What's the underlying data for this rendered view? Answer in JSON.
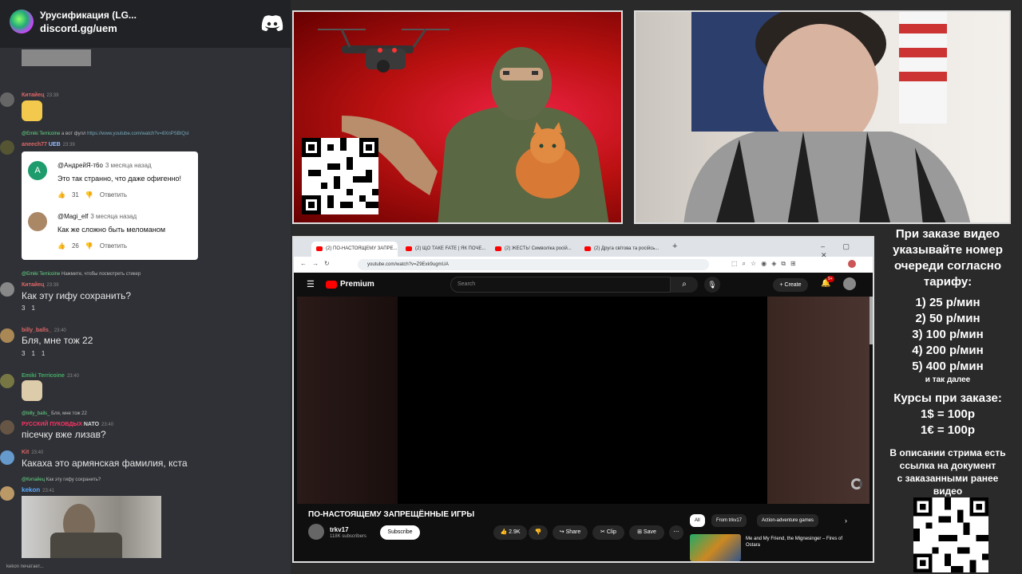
{
  "chat": {
    "server_name": "Урусификация (LG...",
    "server_link": "discord.gg/uem",
    "messages": [
      {
        "user": "Китайец",
        "time": "23:39",
        "color": "#e06666"
      },
      {
        "reply_user": "@Emiki Terricoine",
        "reply_text": "а вот фулл",
        "reply_link": "https://www.youtube.com/watch?v=8XnPSBIQsI",
        "user": "aneech77",
        "badge": "UEB",
        "time": "23:39",
        "color": "#e06666"
      },
      {
        "reply_user": "@Emiki Terricoine",
        "reply_text": "Нажмите, чтобы посмотреть стикер",
        "user": "Китайец",
        "time": "23:39",
        "text": "Как эту гифу сохранить?",
        "reactions": [
          "3",
          "1"
        ],
        "color": "#e06666"
      },
      {
        "user": "billy_balls_",
        "time": "23:40",
        "text": "Бля, мне тож 22",
        "reactions": [
          "3",
          "1",
          "1"
        ],
        "color": "#e06666"
      },
      {
        "user": "Emiki Terricoine",
        "time": "23:40",
        "color": "#44aa66"
      },
      {
        "reply_user": "@billy_balls_",
        "reply_text": "Бля, мне тож 22",
        "user": "РУССКИЙ ПУКОВДЫХ",
        "badge": "NATO",
        "time": "23:40",
        "text": "пісечку вже лизав?",
        "color": "#ff3366"
      },
      {
        "user": "Kit",
        "time": "23:40",
        "text": "Какаха это армянская фамилия, кста",
        "color": "#e06666"
      },
      {
        "reply_user": "@Китайец",
        "reply_text": "Как эту гифу сохранить?",
        "user": "kekon",
        "time": "23:41",
        "color": "#5aa9ff"
      }
    ],
    "youtube_comments": [
      {
        "author": "@АндрейЯ-т6о",
        "ago": "3 месяца назад",
        "text": "Это так странно, что даже офигенно!",
        "likes": "31",
        "reply": "Ответить",
        "avatar_letter": "A"
      },
      {
        "author": "@Magi_elf",
        "ago": "3 месяца назад",
        "text": "Как же сложно быть меломаном",
        "likes": "26",
        "reply": "Ответить"
      }
    ],
    "typing": "kekon печатает..."
  },
  "browser": {
    "tabs": [
      {
        "label": "(2) ПО-НАСТОЯЩЕМУ ЗАПРЕ..."
      },
      {
        "label": "(2) ЩО ТАКЕ FATE | ЯК ПОЧЕ..."
      },
      {
        "label": "(2) ЖЕСТЬ! Символіка росій..."
      },
      {
        "label": "(2) Другa світова та російсь..."
      }
    ],
    "url": "youtube.com/watch?v=Z9Exk9ugmUA"
  },
  "youtube": {
    "brand": "Premium",
    "search_placeholder": "Search",
    "create_label": "Create",
    "notif_count": "9+",
    "video_title": "ПО-НАСТОЯЩЕМУ ЗАПРЕЩЁННЫЕ ИГРЫ",
    "channel_name": "trkv17",
    "channel_subs": "118K subscribers",
    "subscribe_label": "Subscribe",
    "likes": "2.9K",
    "share_label": "Share",
    "clip_label": "Clip",
    "save_label": "Save",
    "chips": [
      "All",
      "From trkv17",
      "Action-adventure games"
    ],
    "rec_title": "Me and My Friend, the Mignesinger – Fires of Ostara"
  },
  "info": {
    "lines": [
      "При заказе видео",
      "указывайте номер",
      "очереди согласно",
      "тарифу:"
    ],
    "tariffs": [
      "1) 25 р/мин",
      "2) 50 р/мин",
      "3) 100 р/мин",
      "4) 200 р/мин",
      "5) 400 р/мин"
    ],
    "etc": "и так далее",
    "courses_title": "Курсы при заказе:",
    "courses": [
      "1$ = 100р",
      "1€ = 100р"
    ],
    "desc": [
      "В описании стрима есть",
      "ссылка на документ",
      "с заказанными ранее",
      "видео"
    ]
  }
}
